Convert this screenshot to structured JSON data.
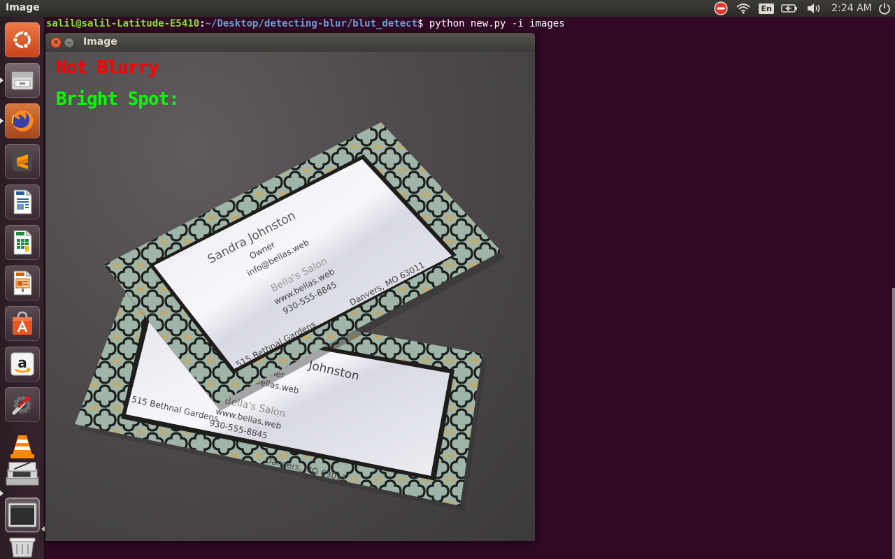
{
  "top_panel": {
    "title": "Image",
    "language": "En",
    "clock": "2:24 AM",
    "icons": [
      "stop-icon",
      "wifi-icon",
      "keyboard-language-icon",
      "battery-icon",
      "volume-icon",
      "power-icon"
    ]
  },
  "launcher": {
    "items": [
      {
        "name": "ubuntu-dash",
        "color": "#e95420"
      },
      {
        "name": "files",
        "color": "#8d8d8d"
      },
      {
        "name": "firefox",
        "color": "#ff7139"
      },
      {
        "name": "sublime-text",
        "color": "#ff9800"
      },
      {
        "name": "libreoffice-writer",
        "color": "#2a6099"
      },
      {
        "name": "libreoffice-calc",
        "color": "#1e8a3c"
      },
      {
        "name": "libreoffice-impress",
        "color": "#d0620b"
      },
      {
        "name": "ubuntu-software",
        "color": "#e95420"
      },
      {
        "name": "amazon",
        "color": "#f0f0f0"
      },
      {
        "name": "system-settings",
        "color": "#6a6a6a"
      },
      {
        "name": "vlc",
        "color": "#ff8800"
      },
      {
        "name": "image-viewer-stack",
        "color": "#c8c8c8"
      },
      {
        "name": "terminal-window",
        "color": "#3a3a3a"
      },
      {
        "name": "trash",
        "color": "#cccccc"
      }
    ]
  },
  "terminal": {
    "user_host": "salil@salil-Latitude-E5410",
    "separator": ":",
    "path": "~/Desktop/detecting-blur/blut_detect",
    "prompt_symbol": "$",
    "command": " python new.py -i images"
  },
  "image_window": {
    "title": "Image",
    "close_glyph": "×",
    "minimize_glyph": "–",
    "status_blur": "Not Blurry",
    "status_bright": "Bright Spot:",
    "status_blur_color": "#ff0000",
    "status_bright_color": "#00ff00"
  },
  "business_card": {
    "name": "Sandra Johnston",
    "role": "Owner",
    "email": "info@bellas.web",
    "salon": "Bella's Salon",
    "website": "www.bellas.web",
    "phone": "930-555-8845",
    "address": "515 Bethnal Gardens",
    "city": "Danvers, MO 63011",
    "back_name": "Johnston",
    "back_email": "s@bellas.web",
    "back_salon": "Bella's Salon",
    "colors": {
      "card_white": "#e8e9ef",
      "pattern_mint": "#9fb5aa",
      "foil_gold": "#c9a860",
      "ink": "#1d1f1c"
    }
  }
}
